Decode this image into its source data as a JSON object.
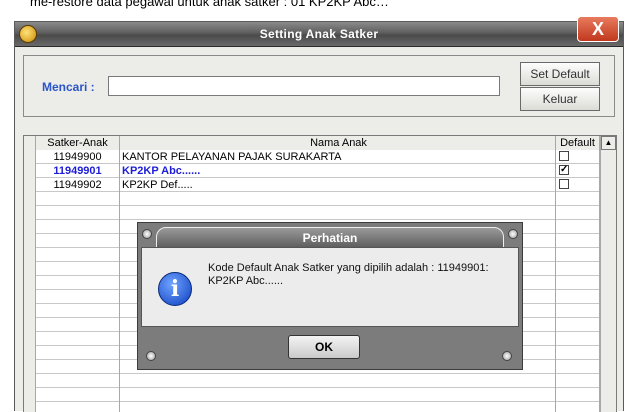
{
  "caption": "me-restore data pegawai untuk anak satker : 01 KP2KP Abc…",
  "window": {
    "title": "Setting Anak Satker",
    "close": "X"
  },
  "search": {
    "label": "Mencari :",
    "value": "",
    "placeholder": ""
  },
  "buttons": {
    "set_default": "Set Default",
    "keluar": "Keluar"
  },
  "table": {
    "headers": {
      "satker": "Satker-Anak",
      "nama": "Nama Anak",
      "default": "Default"
    },
    "rows": [
      {
        "satker": "11949900",
        "nama": "KANTOR PELAYANAN PAJAK SURAKARTA",
        "default": "",
        "selected": false
      },
      {
        "satker": "11949901",
        "nama": "KP2KP Abc......",
        "default": "✓",
        "selected": true
      },
      {
        "satker": "11949902",
        "nama": "KP2KP Def.....",
        "default": "",
        "selected": false
      }
    ]
  },
  "dialog": {
    "title": "Perhatian",
    "message": "Kode Default Anak Satker yang dipilih adalah : 11949901: KP2KP Abc......",
    "ok": "OK",
    "icon": "info-icon"
  }
}
